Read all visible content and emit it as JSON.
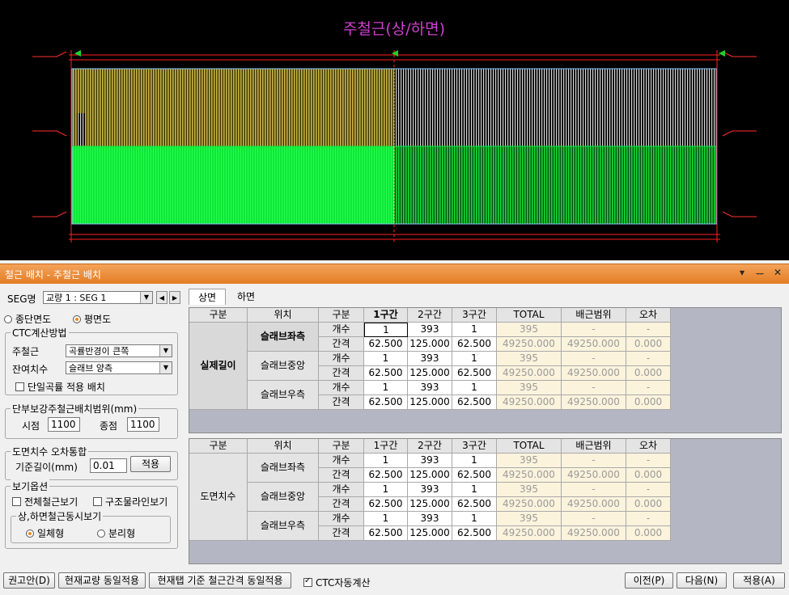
{
  "drawing": {
    "title": "주철근(상/하면)"
  },
  "window": {
    "title": "철근 배치 - 주철근 배치",
    "pin_label": "▾",
    "dock_label": "ᅲ",
    "close_label": "✕"
  },
  "left": {
    "seg_label": "SEG명",
    "seg_value": "교량 1 : SEG 1",
    "view_radios": [
      {
        "label": "종단면도",
        "checked": false
      },
      {
        "label": "평면도",
        "checked": true
      }
    ],
    "ctc_group": "CTC계산방법",
    "main_rebar_label": "주철근",
    "main_rebar_value": "곡률반경이 큰쪽",
    "remainder_label": "잔여치수",
    "remainder_value": "슬래브 양측",
    "single_curve_label": "단일곡률 적용 배치",
    "endrange_group": "단부보강주철근배치범위(mm)",
    "start_label": "시점",
    "start_value": "1100",
    "end_label": "종점",
    "end_value": "1100",
    "tol_group": "도면치수 오차통합",
    "base_len_label": "기준길이(mm)",
    "base_len_value": "0.01",
    "apply_small": "적용",
    "view_group": "보기옵션",
    "view_all_rebar": "전체철근보기",
    "view_struct_line": "구조물라인보기",
    "sub_group": "상,하면철근동시보기",
    "opt_integrated": "일체형",
    "opt_separate": "분리형"
  },
  "tabs": [
    {
      "label": "상면",
      "active": true
    },
    {
      "label": "하면",
      "active": false
    }
  ],
  "headers": [
    "구분",
    "위치",
    "구분",
    "1구간",
    "2구간",
    "3구간",
    "TOTAL",
    "배근범위",
    "오차"
  ],
  "table_upper": {
    "group": "실제길이",
    "blocks": [
      {
        "pos": "슬래브좌측",
        "count": [
          "1",
          "393",
          "1",
          "395",
          "-",
          "-"
        ],
        "space": [
          "62.500",
          "125.000",
          "62.500",
          "49250.000",
          "49250.000",
          "0.000"
        ]
      },
      {
        "pos": "슬래브중앙",
        "count": [
          "1",
          "393",
          "1",
          "395",
          "-",
          "-"
        ],
        "space": [
          "62.500",
          "125.000",
          "62.500",
          "49250.000",
          "49250.000",
          "0.000"
        ]
      },
      {
        "pos": "슬래브우측",
        "count": [
          "1",
          "393",
          "1",
          "395",
          "-",
          "-"
        ],
        "space": [
          "62.500",
          "125.000",
          "62.500",
          "49250.000",
          "49250.000",
          "0.000"
        ]
      }
    ]
  },
  "table_lower": {
    "group": "도면치수",
    "blocks": [
      {
        "pos": "슬래브좌측",
        "count": [
          "1",
          "393",
          "1",
          "395",
          "-",
          "-"
        ],
        "space": [
          "62.500",
          "125.000",
          "62.500",
          "49250.000",
          "49250.000",
          "0.000"
        ]
      },
      {
        "pos": "슬래브중앙",
        "count": [
          "1",
          "393",
          "1",
          "395",
          "-",
          "-"
        ],
        "space": [
          "62.500",
          "125.000",
          "62.500",
          "49250.000",
          "49250.000",
          "0.000"
        ]
      },
      {
        "pos": "슬래브우측",
        "count": [
          "1",
          "393",
          "1",
          "395",
          "-",
          "-"
        ],
        "space": [
          "62.500",
          "125.000",
          "62.500",
          "49250.000",
          "49250.000",
          "0.000"
        ]
      }
    ]
  },
  "row_labels": {
    "count": "개수",
    "space": "간격"
  },
  "bottom": {
    "recommend": "권고안(D)",
    "same_bridge": "현재교량 동일적용",
    "same_tab": "현재탭 기준 철근간격 동일적용",
    "ctc_auto": "CTC자동계산",
    "prev": "이전(P)",
    "next": "다음(N)",
    "apply": "적용(A)"
  },
  "colors": {
    "yellow": "#c8b44a",
    "green": "#10e63a",
    "red": "#ff2020",
    "accent": "#e8822a"
  }
}
